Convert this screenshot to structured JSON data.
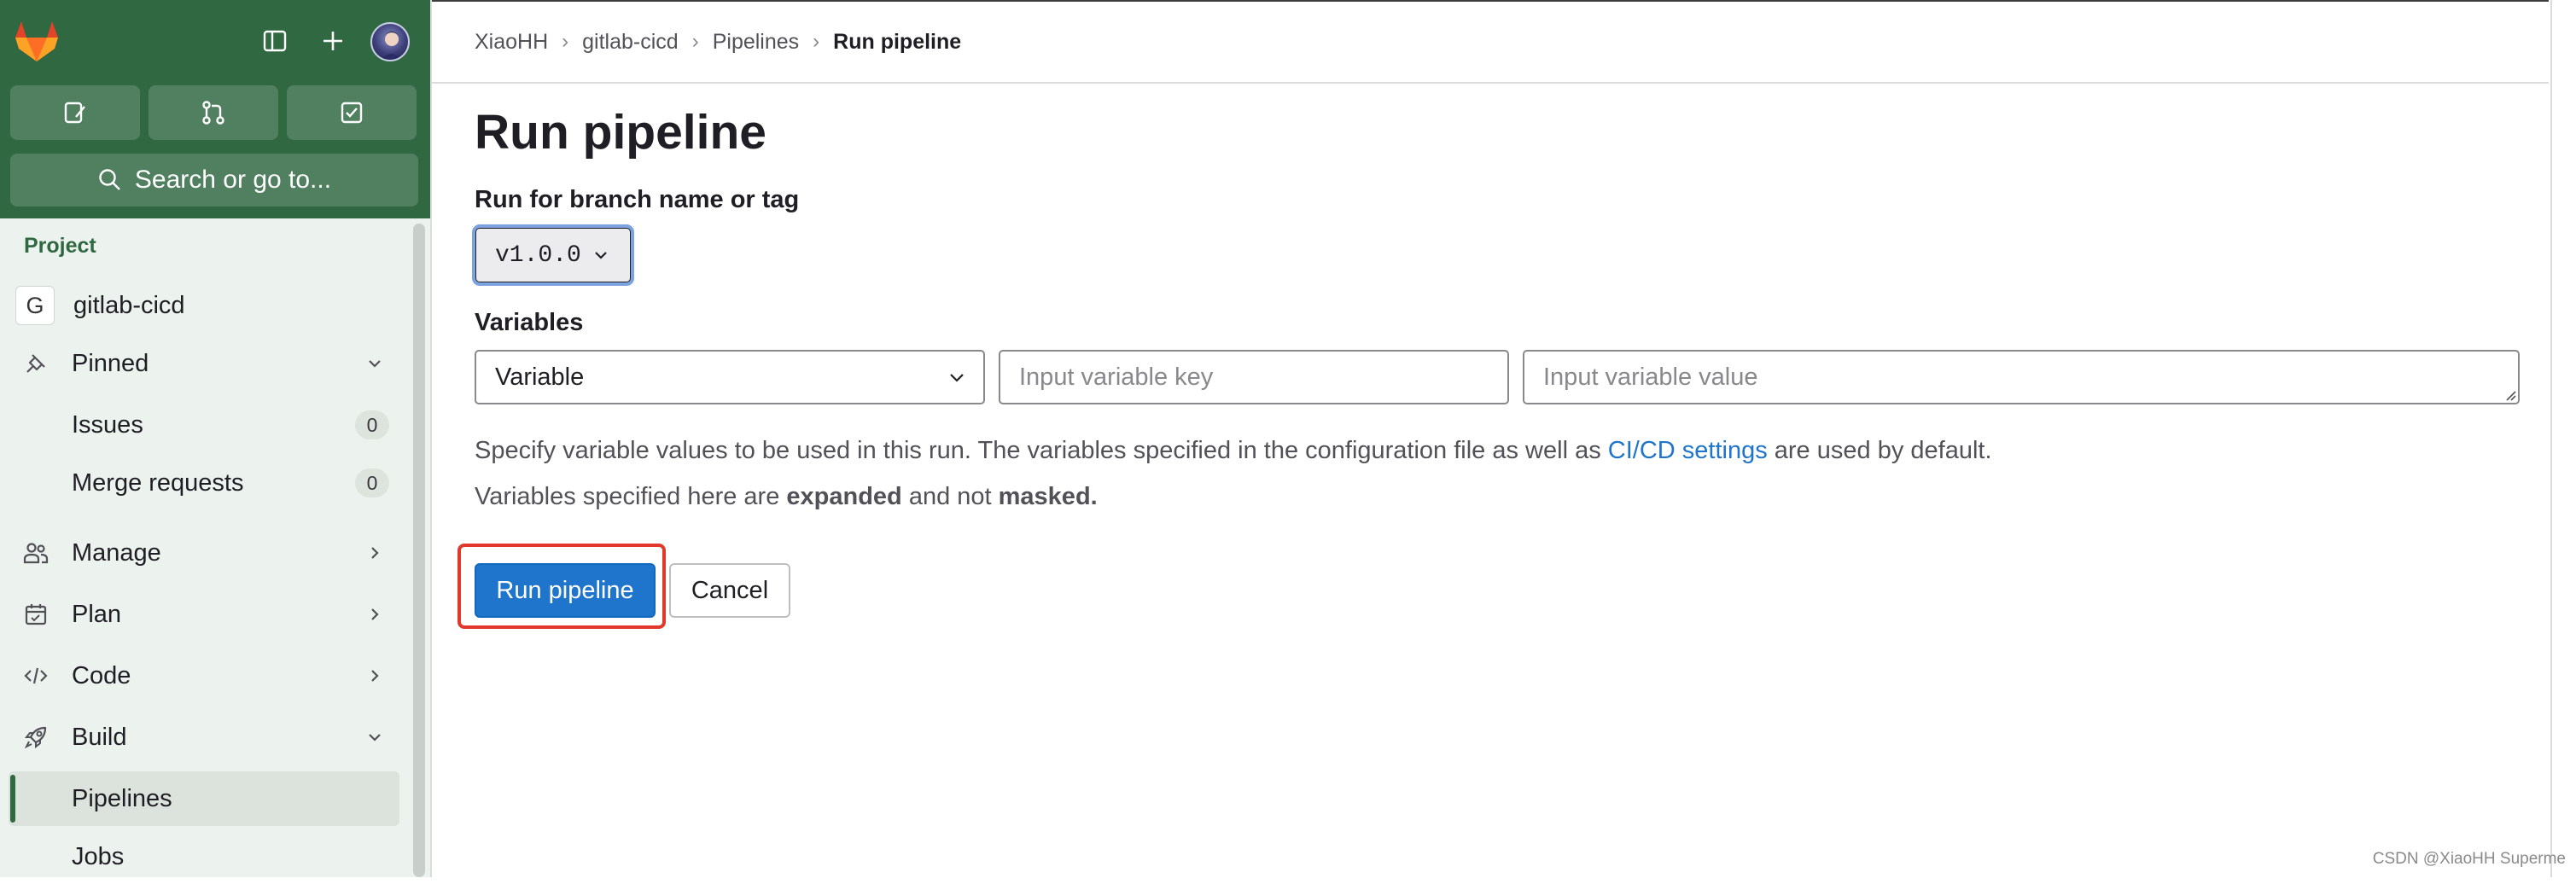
{
  "sidebar": {
    "search_label": "Search or go to...",
    "section_title": "Project",
    "project": {
      "initial": "G",
      "name": "gitlab-cicd"
    },
    "items": [
      {
        "label": "Pinned",
        "icon": "thumbtack-icon"
      },
      {
        "label": "Issues",
        "count": "0"
      },
      {
        "label": "Merge requests",
        "count": "0"
      },
      {
        "label": "Manage",
        "icon": "users-icon"
      },
      {
        "label": "Plan",
        "icon": "calendar-icon"
      },
      {
        "label": "Code",
        "icon": "code-icon"
      },
      {
        "label": "Build",
        "icon": "rocket-icon"
      },
      {
        "label": "Pipelines"
      },
      {
        "label": "Jobs"
      }
    ],
    "accent_color": "#2f6841"
  },
  "breadcrumb": [
    "XiaoHH",
    "gitlab-cicd",
    "Pipelines",
    "Run pipeline"
  ],
  "page": {
    "title": "Run pipeline",
    "ref_label": "Run for branch name or tag",
    "ref_value": "v1.0.0",
    "variables_label": "Variables",
    "variable_type": "Variable",
    "key_placeholder": "Input variable key",
    "value_placeholder": "Input variable value",
    "help_line1_pre": "Specify variable values to be used in this run. The variables specified in the configuration file as well as ",
    "help_link": "CI/CD settings",
    "help_line1_post": " are used by default.",
    "help_line2_pre": "Variables specified here are ",
    "help_line2_b1": "expanded",
    "help_line2_mid": " and not ",
    "help_line2_b2": "masked.",
    "run_button": "Run pipeline",
    "cancel_button": "Cancel",
    "primary_color": "#1f75cb",
    "highlight_color": "#e0392b"
  },
  "watermark": "CSDN @XiaoHH Superme"
}
